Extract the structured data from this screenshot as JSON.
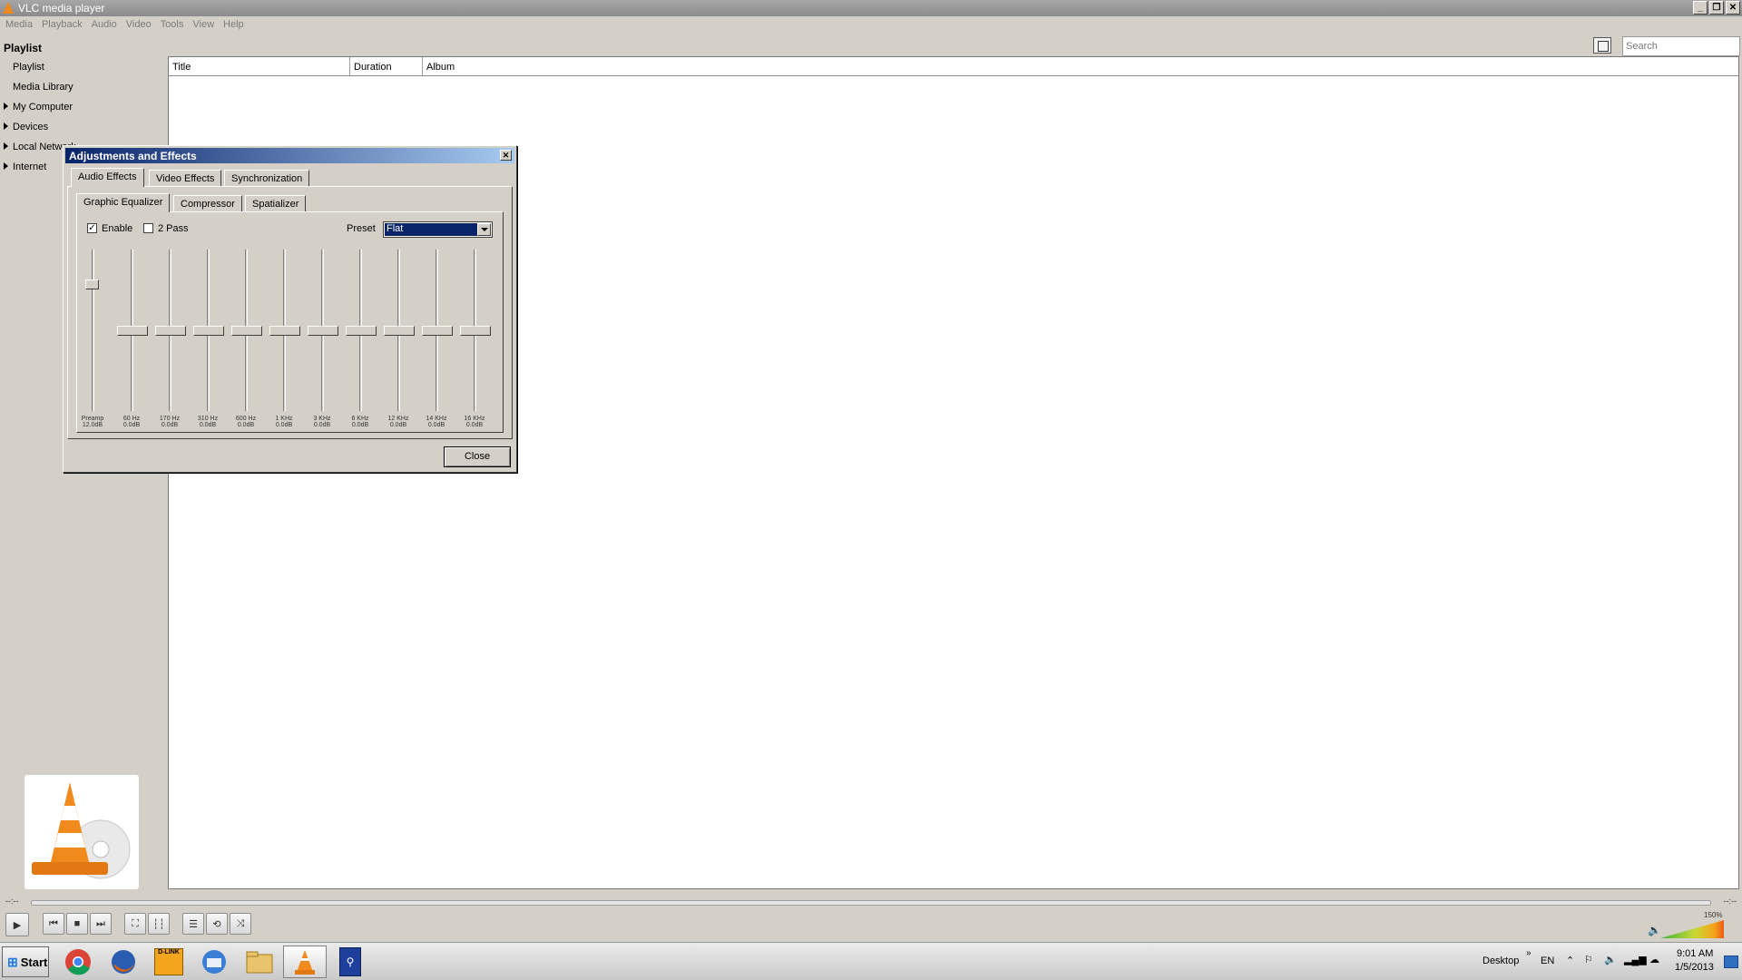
{
  "window": {
    "title": "VLC media player"
  },
  "menu": [
    "Media",
    "Playback",
    "Audio",
    "Video",
    "Tools",
    "View",
    "Help"
  ],
  "sidebar": {
    "title": "Playlist",
    "items": [
      {
        "label": "Playlist",
        "expandable": false
      },
      {
        "label": "Media Library",
        "expandable": false
      },
      {
        "label": "My Computer",
        "expandable": true
      },
      {
        "label": "Devices",
        "expandable": true
      },
      {
        "label": "Local Network",
        "expandable": true
      },
      {
        "label": "Internet",
        "expandable": true
      }
    ]
  },
  "playlist": {
    "columns": [
      "Title",
      "Duration",
      "Album"
    ],
    "search_placeholder": "Search"
  },
  "dialog": {
    "title": "Adjustments and Effects",
    "tabs": [
      "Audio Effects",
      "Video Effects",
      "Synchronization"
    ],
    "subtabs": [
      "Graphic Equalizer",
      "Compressor",
      "Spatializer"
    ],
    "enable_label": "Enable",
    "enable_checked": true,
    "twopass_label": "2 Pass",
    "twopass_checked": false,
    "preset_label": "Preset",
    "preset_value": "Flat",
    "bands": [
      {
        "name": "Preamp",
        "value": "12.0dB",
        "level": 0.8
      },
      {
        "name": "60 Hz",
        "value": "0.0dB",
        "level": 0.5
      },
      {
        "name": "170 Hz",
        "value": "0.0dB",
        "level": 0.5
      },
      {
        "name": "310 Hz",
        "value": "0.0dB",
        "level": 0.5
      },
      {
        "name": "600 Hz",
        "value": "0.0dB",
        "level": 0.5
      },
      {
        "name": "1 KHz",
        "value": "0.0dB",
        "level": 0.5
      },
      {
        "name": "3 KHz",
        "value": "0.0dB",
        "level": 0.5
      },
      {
        "name": "6 KHz",
        "value": "0.0dB",
        "level": 0.5
      },
      {
        "name": "12 KHz",
        "value": "0.0dB",
        "level": 0.5
      },
      {
        "name": "14 KHz",
        "value": "0.0dB",
        "level": 0.5
      },
      {
        "name": "16 KHz",
        "value": "0.0dB",
        "level": 0.5
      }
    ],
    "close_label": "Close"
  },
  "player": {
    "elapsed": "--:--",
    "remaining": "--:--",
    "volume": "150%",
    "volume_level": 1.0
  },
  "taskbar": {
    "start_label": "Start",
    "apps": [
      "chrome-icon",
      "firefox-icon",
      "dlink-icon",
      "thunderbird-icon",
      "folder-icon",
      "vlc-icon",
      "tool-icon"
    ],
    "active_app": "vlc-icon",
    "desktop_label": "Desktop",
    "lang": "EN",
    "time": "9:01 AM",
    "date": "1/5/2013"
  },
  "colors": {
    "dialog_title": "#0a246a",
    "vlc_orange": "#f08a1c"
  }
}
